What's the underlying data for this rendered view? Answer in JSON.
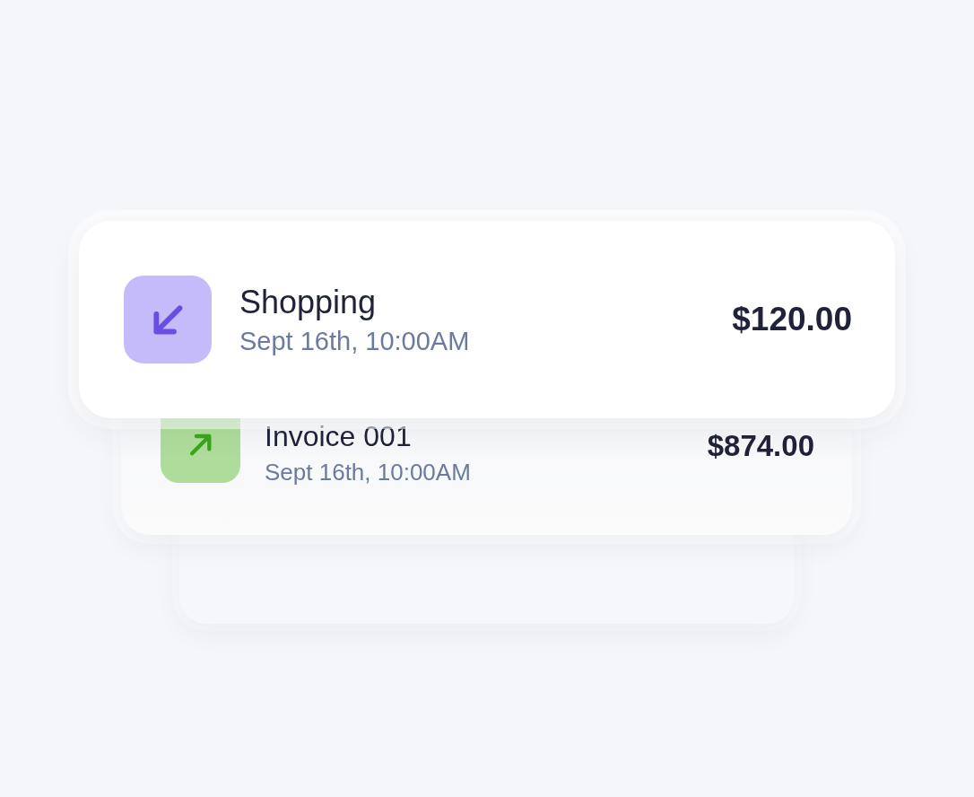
{
  "transactions": [
    {
      "kind": "expense",
      "title": "Shopping",
      "date": "Sept 16th, 10:00AM",
      "amount": "$120.00"
    },
    {
      "kind": "income",
      "title": "Invoice 001",
      "date": "Sept 16th, 10:00AM",
      "amount": "$874.00"
    }
  ]
}
